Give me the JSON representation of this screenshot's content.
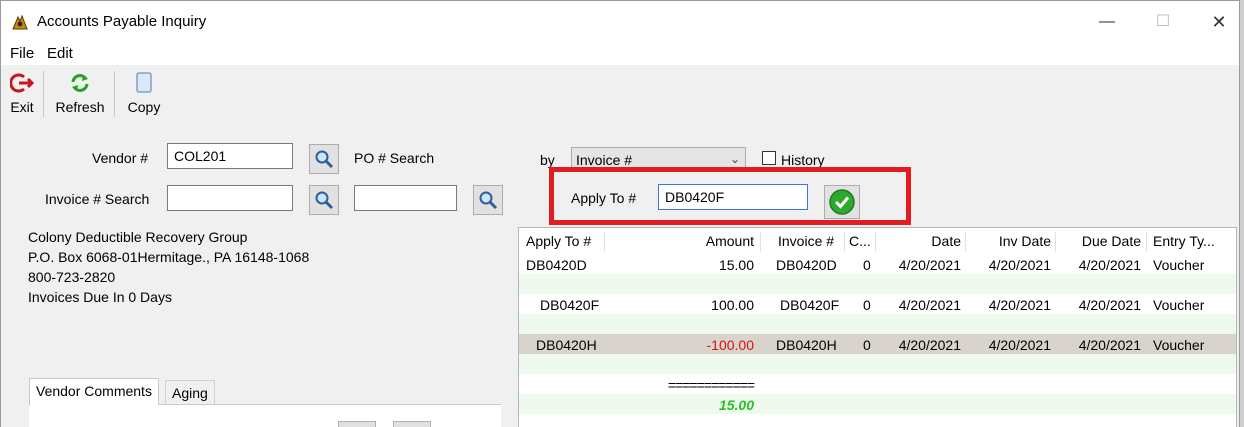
{
  "window": {
    "title": "Accounts Payable Inquiry",
    "controls": {
      "minimize": "—",
      "maximize": "☐",
      "close": "✕"
    }
  },
  "menu": {
    "file": "File",
    "edit": "Edit"
  },
  "toolbar": {
    "exit": "Exit",
    "refresh": "Refresh",
    "copy": "Copy"
  },
  "form": {
    "vendor_label": "Vendor #",
    "vendor_value": "COL201",
    "po_search_label": "PO # Search",
    "invoice_search_label": "Invoice # Search",
    "invoice_search_value": "",
    "po_search_value": "",
    "by_label": "by",
    "by_selected": "Invoice #",
    "history_label": "History",
    "history_checked": false,
    "apply_to_label": "Apply To #",
    "apply_to_value": "DB0420F"
  },
  "vendor_info": {
    "name": "Colony Deductible Recovery Group",
    "address": "P.O. Box 6068-01Hermitage., PA  16148-1068",
    "phone": "800-723-2820",
    "due_note": "Invoices Due In 0 Days"
  },
  "grid": {
    "columns": [
      "Apply To #",
      "Amount",
      "Invoice #",
      "C...",
      "Date",
      "Inv Date",
      "Due Date",
      "Entry Ty..."
    ],
    "rows": [
      {
        "apply_to": "DB0420D",
        "amount": "15.00",
        "invoice": "DB0420D",
        "c": "0",
        "date": "4/20/2021",
        "inv_date": "4/20/2021",
        "due_date": "4/20/2021",
        "entry_type": "Voucher"
      },
      {
        "apply_to": "DB0420F",
        "amount": "100.00",
        "invoice": "DB0420F",
        "c": "0",
        "date": "4/20/2021",
        "inv_date": "4/20/2021",
        "due_date": "4/20/2021",
        "entry_type": "Voucher"
      },
      {
        "apply_to": "DB0420H",
        "amount": "-100.00",
        "invoice": "DB0420H",
        "c": "0",
        "date": "4/20/2021",
        "inv_date": "4/20/2021",
        "due_date": "4/20/2021",
        "entry_type": "Voucher"
      }
    ],
    "total_rule": "============",
    "total": "15.00"
  },
  "tabs": {
    "vendor_comments": "Vendor Comments",
    "aging": "Aging"
  },
  "colors": {
    "highlight": "#e31b23",
    "negative": "#d9130d",
    "total": "#29c027",
    "selected_row": "#d8d3cd",
    "band": "#eefaee"
  },
  "icons": [
    "app-icon",
    "exit-icon",
    "refresh-icon",
    "copy-icon",
    "search-icon",
    "ok-check-icon",
    "chevron-down-icon"
  ]
}
